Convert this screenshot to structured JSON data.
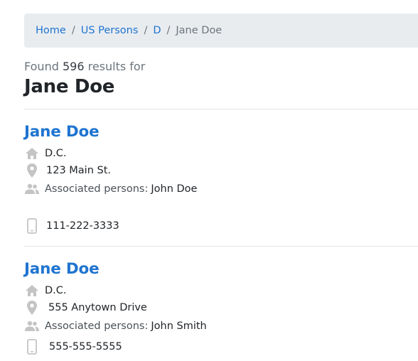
{
  "breadcrumb": {
    "items": [
      "Home",
      "US Persons",
      "D"
    ],
    "separator": "/",
    "current": "Jane Doe"
  },
  "search": {
    "found_prefix": "Found",
    "count": "596",
    "found_suffix": "results for",
    "query": "Jane Doe"
  },
  "results": [
    {
      "name": "Jane Doe",
      "region": "D.C.",
      "address": "123 Main St.",
      "associated_label": "Associated persons:",
      "associated": "John Doe",
      "phone": "111-222-3333"
    },
    {
      "name": "Jane Doe",
      "region": "D.C.",
      "address": "555 Anytown Drive",
      "associated_label": "Associated persons:",
      "associated": "John Smith",
      "phone": "555-555-5555"
    }
  ],
  "icons": {
    "home": "home-icon",
    "location": "location-pin-icon",
    "people": "people-icon",
    "phone": "phone-icon"
  },
  "colors": {
    "link": "#1f74d0",
    "icon": "#c4c4c4",
    "breadcrumb_bg": "#e9ecef"
  }
}
